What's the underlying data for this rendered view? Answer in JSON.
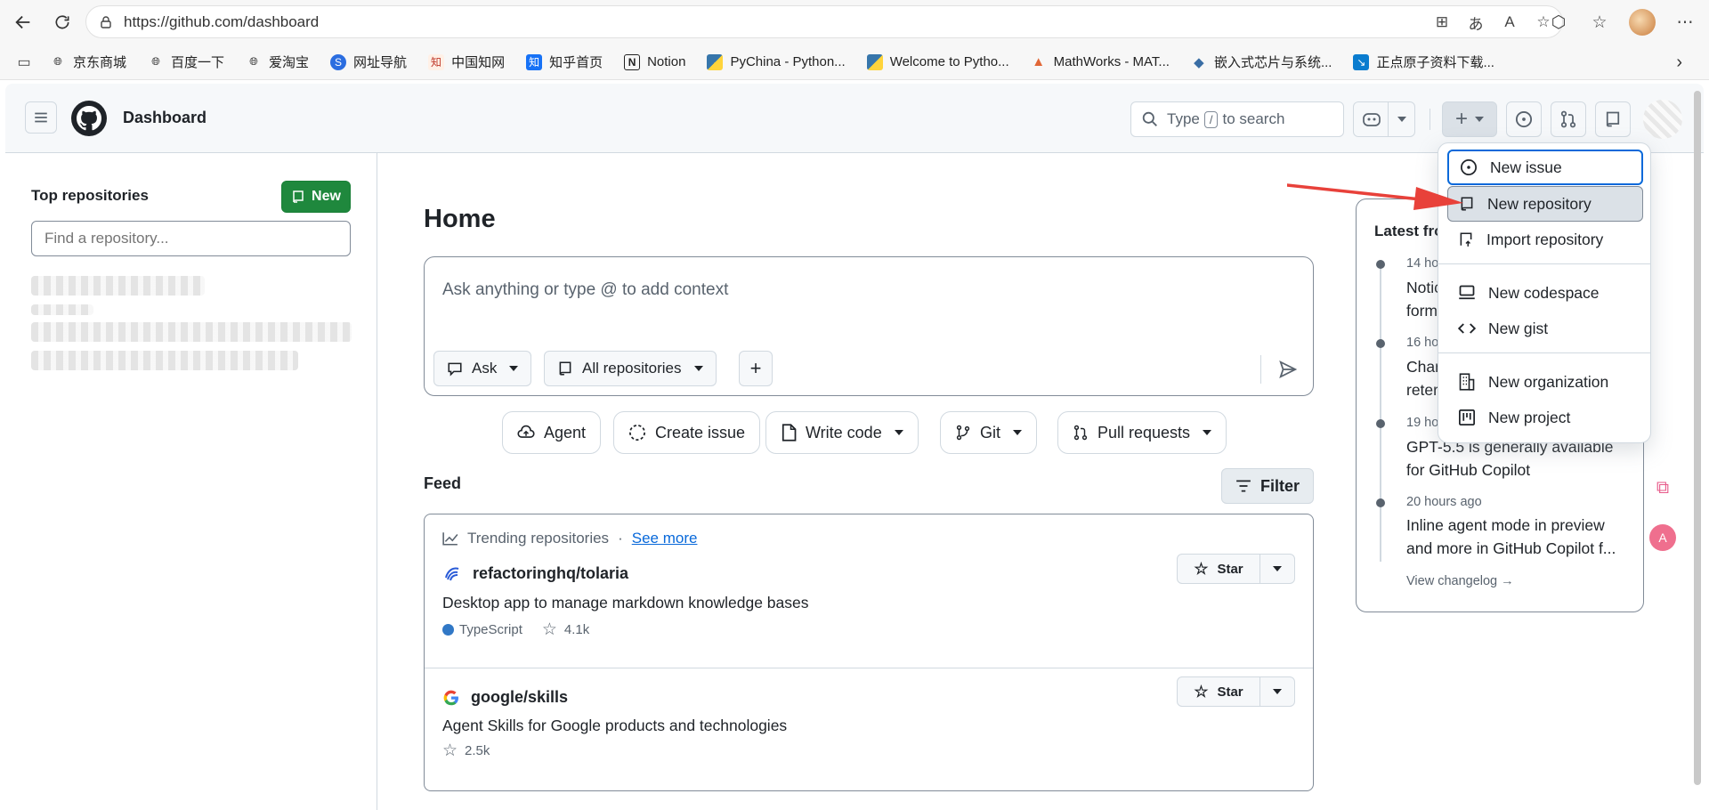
{
  "browser": {
    "url": "https://github.com/dashboard",
    "bookmarks": [
      {
        "label": "京东商城",
        "icon": "globe-icon"
      },
      {
        "label": "百度一下",
        "icon": "globe-icon"
      },
      {
        "label": "爱淘宝",
        "icon": "globe-icon"
      },
      {
        "label": "网址导航",
        "icon": "sogou-icon"
      },
      {
        "label": "中国知网",
        "icon": "cnki-icon"
      },
      {
        "label": "知乎首页",
        "icon": "zhihu-icon"
      },
      {
        "label": "Notion",
        "icon": "notion-icon"
      },
      {
        "label": "PyChina - Python...",
        "icon": "python-icon"
      },
      {
        "label": "Welcome to Pytho...",
        "icon": "python-icon"
      },
      {
        "label": "MathWorks - MAT...",
        "icon": "matlab-icon"
      },
      {
        "label": "嵌入式芯片与系统...",
        "icon": "chip-icon"
      },
      {
        "label": "正点原子资料下载...",
        "icon": "download-icon"
      }
    ]
  },
  "header": {
    "title": "Dashboard",
    "search_prefix": "Type",
    "search_key": "/",
    "search_suffix": "to search"
  },
  "sidebar": {
    "title": "Top repositories",
    "new_label": "New",
    "find_placeholder": "Find a repository..."
  },
  "main": {
    "title": "Home",
    "chat_placeholder": "Ask anything or type @ to add context",
    "chat_ask": "Ask",
    "chat_repos": "All repositories",
    "actions": [
      {
        "label": "Agent",
        "icon": "agent-icon"
      },
      {
        "label": "Create issue",
        "icon": "issue-draft-icon"
      },
      {
        "label": "Write code",
        "icon": "file-icon"
      },
      {
        "label": "Git",
        "icon": "git-branch-icon"
      },
      {
        "label": "Pull requests",
        "icon": "pull-request-icon"
      }
    ],
    "feed_title": "Feed",
    "filter_label": "Filter",
    "trending_label": "Trending repositories",
    "trending_sep": "·",
    "see_more": "See more",
    "repos": [
      {
        "name": "refactoringhq/tolaria",
        "description": "Desktop app to manage markdown knowledge bases",
        "language": "TypeScript",
        "stars": "4.1k",
        "star_label": "Star"
      },
      {
        "name": "google/skills",
        "description": "Agent Skills for Google products and technologies",
        "language": "",
        "stars": "2.5k",
        "star_label": "Star"
      }
    ]
  },
  "changelog": {
    "title": "Latest fro",
    "entries": [
      {
        "time": "14 ho",
        "text": "Notic form"
      },
      {
        "time": "16 ho",
        "text": "Char reter"
      },
      {
        "time": "19 ho",
        "text": "GPT-5.5 is generally available for GitHub Copilot"
      },
      {
        "time": "20 hours ago",
        "text": "Inline agent mode in preview and more in GitHub Copilot f..."
      }
    ],
    "view_all": "View changelog →"
  },
  "new_menu": {
    "items": [
      {
        "label": "New issue",
        "icon": "issue-opened-icon"
      },
      {
        "label": "New repository",
        "icon": "repo-icon"
      },
      {
        "label": "Import repository",
        "icon": "repo-push-icon"
      },
      {
        "label": "New codespace",
        "icon": "codespaces-icon"
      },
      {
        "label": "New gist",
        "icon": "code-icon"
      },
      {
        "label": "New organization",
        "icon": "organization-icon"
      },
      {
        "label": "New project",
        "icon": "project-icon"
      }
    ]
  },
  "colors": {
    "primary_green": "#1f883d",
    "link_blue": "#0969da",
    "annotation_red": "#e8413a",
    "typescript": "#3178c6"
  }
}
